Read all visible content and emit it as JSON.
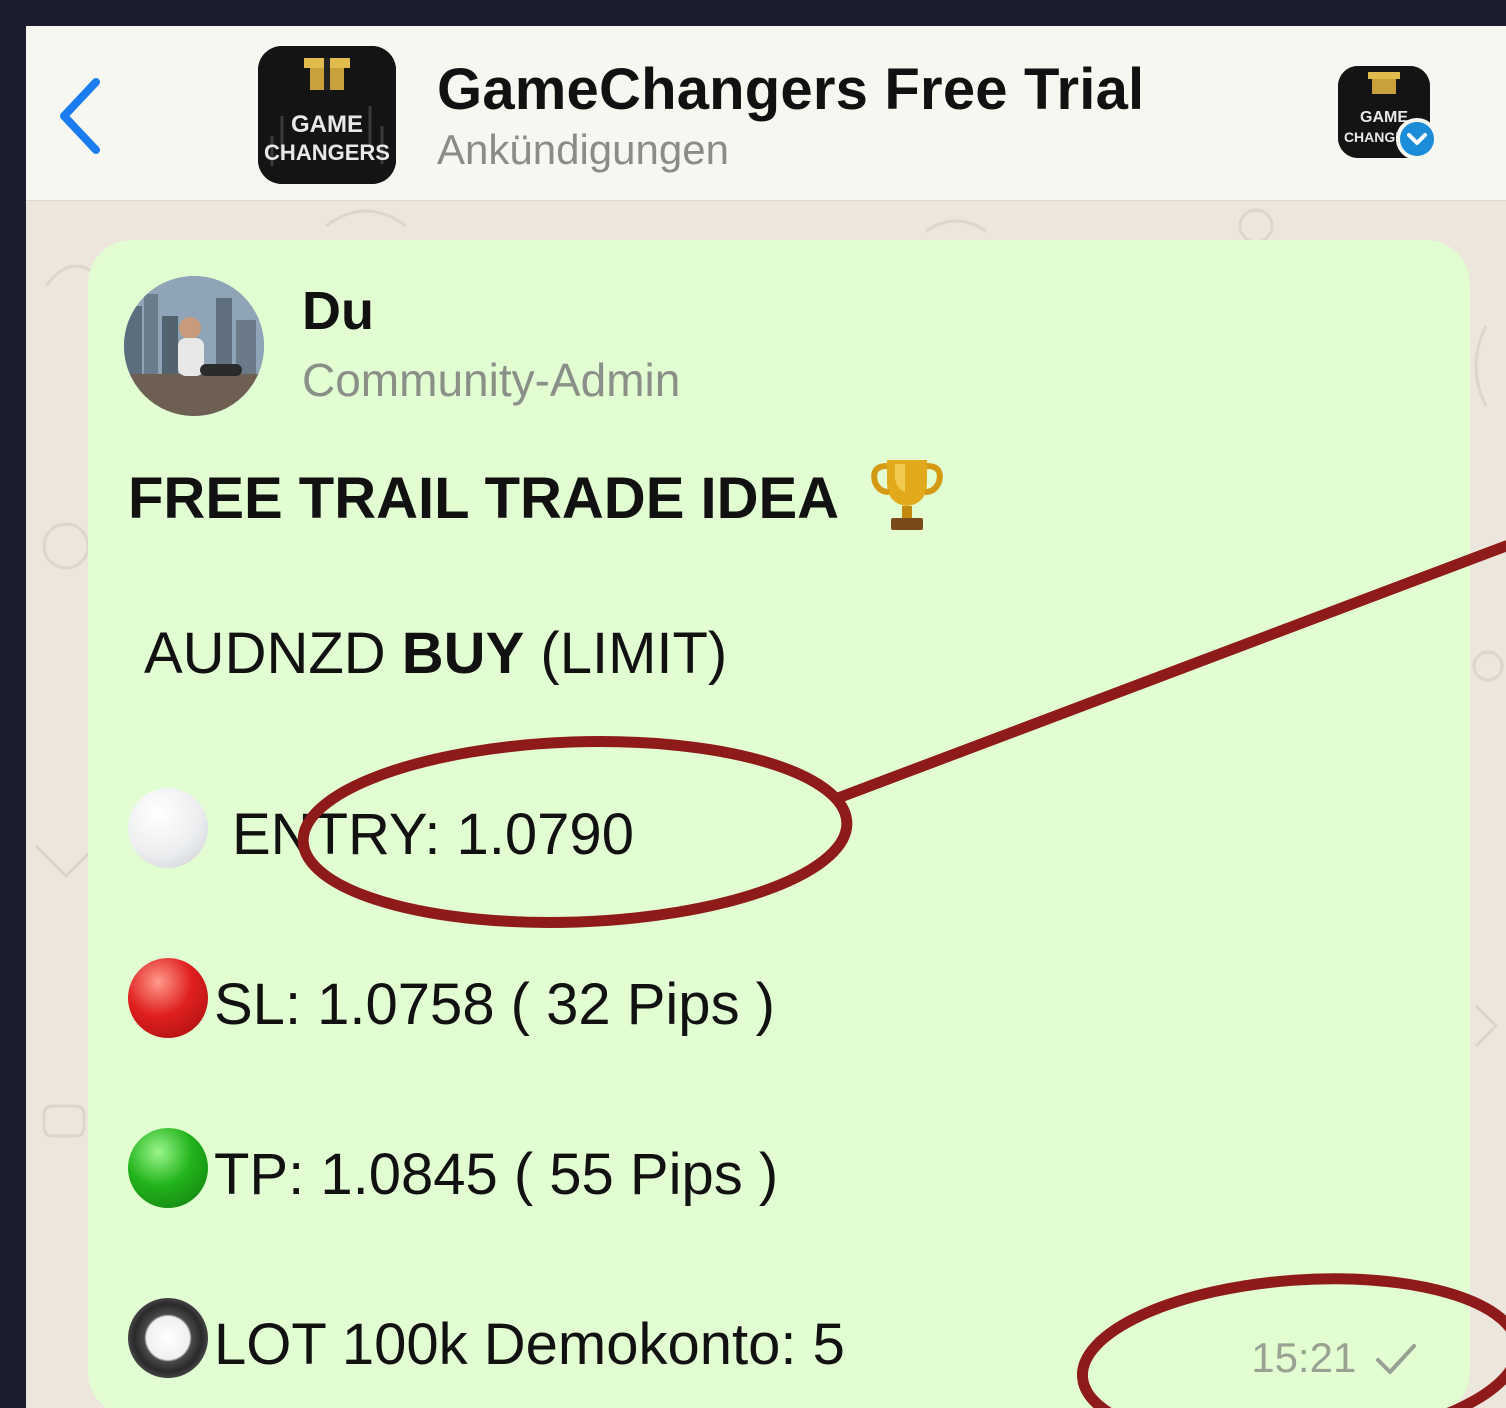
{
  "header": {
    "back_icon": "chevron-left-icon",
    "title": "GameChangers Free Trial",
    "subtitle": "Ankündigungen",
    "logo_lines": [
      "GAME",
      "CHANGERS"
    ]
  },
  "message": {
    "sender": "Du",
    "role": "Community-Admin",
    "headline": "FREE TRAIL TRADE IDEA",
    "headline_emoji": "🏆",
    "pair": "AUDNZD",
    "direction": "BUY",
    "order_type": "(LIMIT)",
    "entry": "ENTRY: 1.0790",
    "sl": "SL: 1.0758 ( 32 Pips )",
    "tp": "TP: 1.0845 ( 55 Pips )",
    "lot": "LOT 100k Demokonto: 5",
    "time": "15:21",
    "status_icon": "check-icon"
  },
  "colors": {
    "accent": "#1a7cf0",
    "bubble": "#e1fdd1",
    "annotation": "#8f1a1a"
  }
}
